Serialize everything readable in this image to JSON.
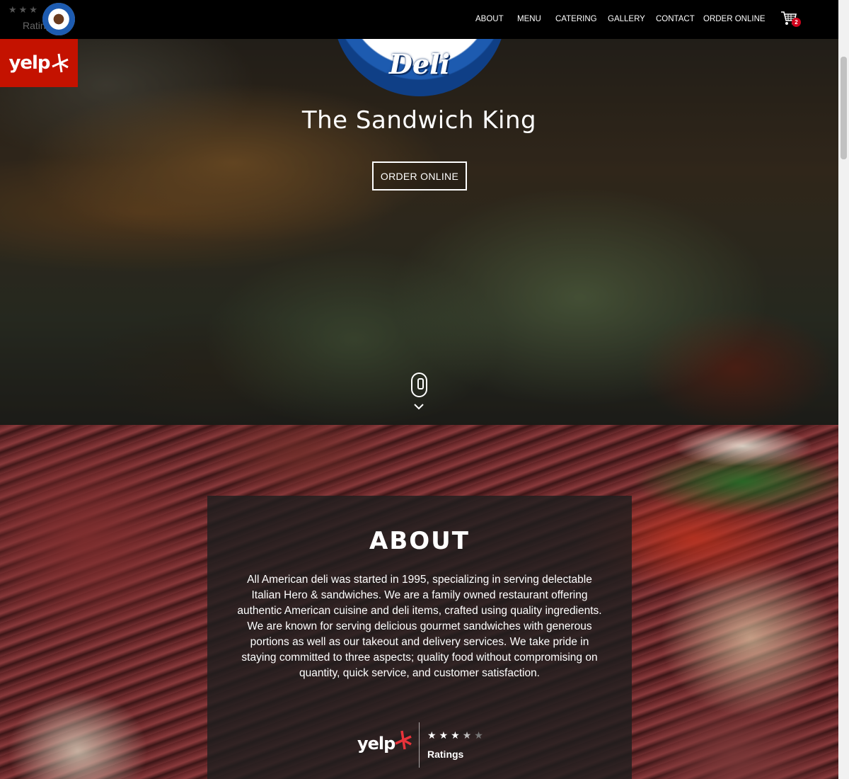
{
  "nav": {
    "rating_label": "Ratings",
    "rating_stars": "★★★",
    "links": [
      "ABOUT",
      "MENU",
      "CATERING",
      "GALLERY",
      "CONTACT",
      "ORDER ONLINE"
    ],
    "cart_count": "2"
  },
  "yelp": {
    "wordmark": "yelp"
  },
  "hero": {
    "logo_text": "Deli",
    "title": "The Sandwich King",
    "cta_label": "ORDER ONLINE"
  },
  "about": {
    "title": "ABOUT",
    "body": "All American deli was started in 1995, specializing in serving delectable Italian Hero & sandwiches. We are a family owned restaurant offering authentic American cuisine and deli items, crafted using quality ingredients.\nWe are known for serving delicious gourmet sandwiches with generous portions as well as our takeout and delivery services. We take pride in staying committed to three aspects; quality food without compromising on quantity, quick service, and customer satisfaction.",
    "rating_label": "Ratings",
    "rating_stars": 3.5,
    "rating_max": 5
  },
  "colors": {
    "yelp_red": "#c41200",
    "navbar_bg": "#000000",
    "badge_red": "#d0021b"
  },
  "icons": {
    "cart": "shopping-cart-icon",
    "scroll": "mouse-scroll-icon",
    "arrow": "chevron-down-icon",
    "yelp_burst": "yelp-burst-icon"
  }
}
